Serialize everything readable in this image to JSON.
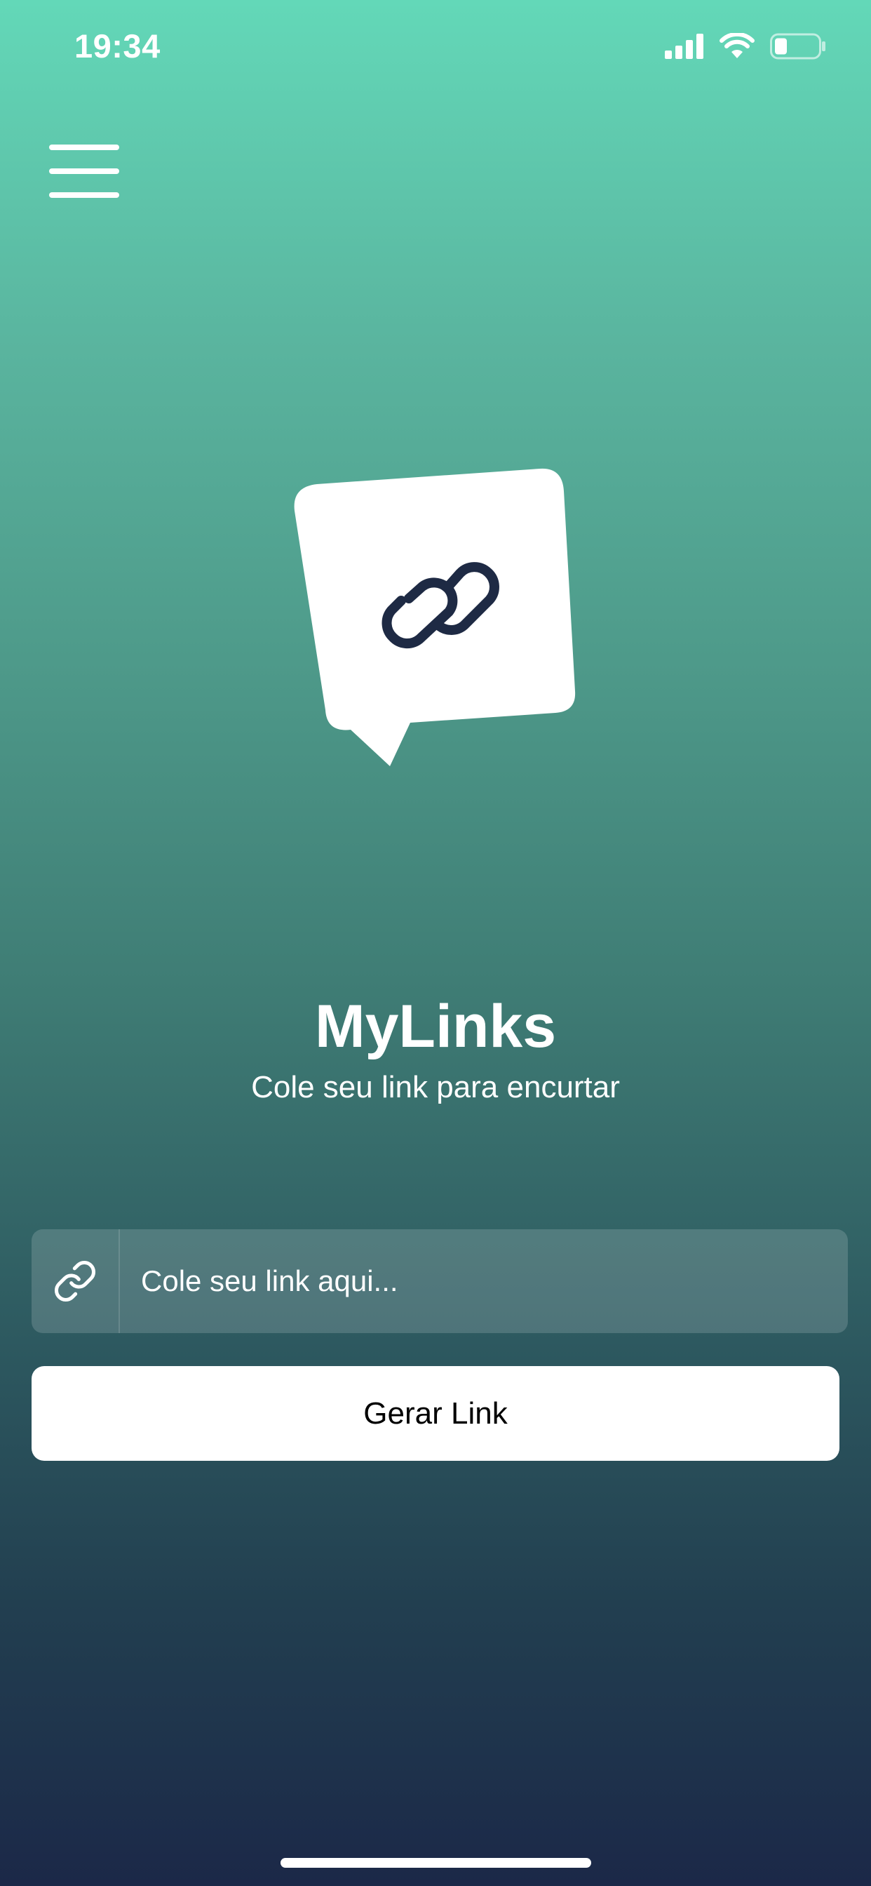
{
  "status_bar": {
    "time": "19:34",
    "icons": [
      "cellular-signal-icon",
      "wifi-icon",
      "battery-icon"
    ]
  },
  "header": {
    "menu_icon": "hamburger-menu-icon"
  },
  "logo": {
    "icon": "chain-link-speech-bubble-icon"
  },
  "main": {
    "title": "MyLinks",
    "subtitle": "Cole seu link para encurtar",
    "input": {
      "icon": "link-icon",
      "placeholder": "Cole seu link aqui...",
      "value": ""
    },
    "button_label": "Gerar Link"
  },
  "colors": {
    "gradient_top": "#63d8b8",
    "gradient_bottom": "#1b2848",
    "button_bg": "#ffffff",
    "logo_stroke": "#1e2a44"
  }
}
